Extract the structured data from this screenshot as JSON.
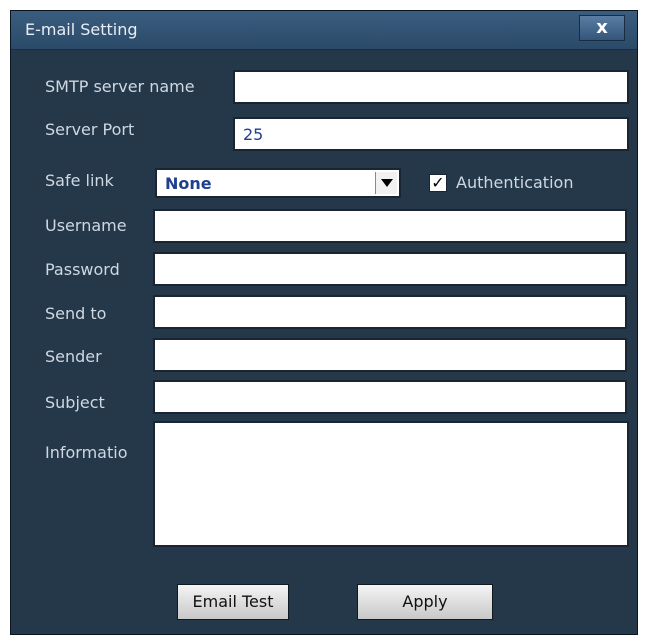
{
  "dialog": {
    "title": "E-mail Setting",
    "close_label": "x"
  },
  "fields": {
    "smtp_server_name": {
      "label": "SMTP server name",
      "value": ""
    },
    "server_port": {
      "label": "Server Port",
      "value": "25"
    },
    "safe_link": {
      "label": "Safe link",
      "selected": "None"
    },
    "authentication": {
      "label": "Authentication",
      "checked": true,
      "mark": "✓"
    },
    "username": {
      "label": "Username",
      "value": ""
    },
    "password": {
      "label": "Password",
      "value": ""
    },
    "send_to": {
      "label": "Send to",
      "value": ""
    },
    "sender": {
      "label": "Sender",
      "value": ""
    },
    "subject": {
      "label": "Subject",
      "value": ""
    },
    "information": {
      "label": "Informatio",
      "value": ""
    }
  },
  "buttons": {
    "email_test": "Email Test",
    "apply": "Apply"
  },
  "colors": {
    "window_bg": "#243849",
    "titlebar": "#34557a",
    "label_text": "#cfd8e2",
    "value_text": "#1f3f8f"
  }
}
